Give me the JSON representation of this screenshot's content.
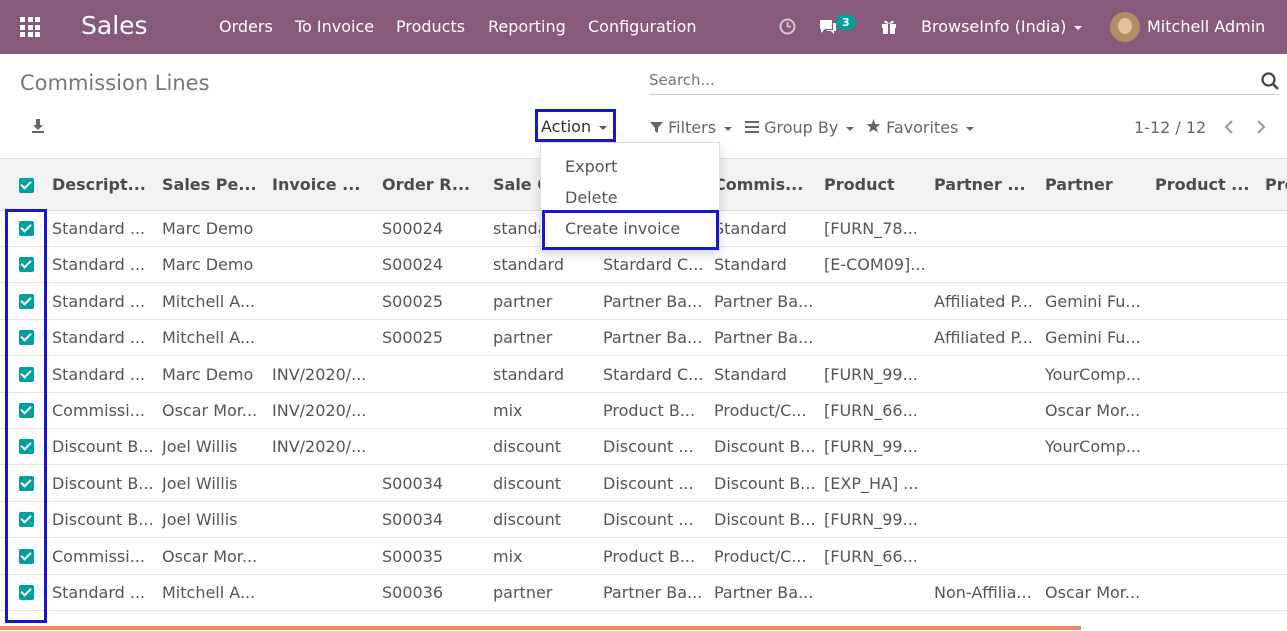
{
  "navbar": {
    "app_name": "Sales",
    "menu": [
      "Orders",
      "To Invoice",
      "Products",
      "Reporting",
      "Configuration"
    ],
    "message_count": "3",
    "company": "BrowseInfo (India)",
    "user": "Mitchell Admin",
    "color": "#875a7b"
  },
  "page": {
    "title": "Commission Lines",
    "search_placeholder": "Search...",
    "action_label": "Action",
    "filters_label": "Filters",
    "groupby_label": "Group By",
    "favorites_label": "Favorites",
    "pager": "1-12 / 12"
  },
  "action_menu": {
    "items": [
      "Export",
      "Delete",
      "Create invoice"
    ]
  },
  "table": {
    "headers": [
      "Descript...",
      "Sales Pe...",
      "Invoice ...",
      "Order R...",
      "Sale C",
      "Commis...",
      "Product",
      "Partner ...",
      "Partner",
      "Product ...",
      "Pro"
    ],
    "rows": [
      [
        "Standard ...",
        "Marc Demo",
        "",
        "S00024",
        "standa",
        "",
        "Standard",
        "[FURN_78...",
        "",
        "",
        ""
      ],
      [
        "Standard ...",
        "Marc Demo",
        "",
        "S00024",
        "standard",
        "Stardard C...",
        "Standard",
        "[E-COM09]...",
        "",
        "",
        ""
      ],
      [
        "Standard ...",
        "Mitchell A...",
        "",
        "S00025",
        "partner",
        "Partner Ba...",
        "Partner Ba...",
        "",
        "Affiliated P...",
        "Gemini Fu...",
        ""
      ],
      [
        "Standard ...",
        "Mitchell A...",
        "",
        "S00025",
        "partner",
        "Partner Ba...",
        "Partner Ba...",
        "",
        "Affiliated P...",
        "Gemini Fu...",
        ""
      ],
      [
        "Standard ...",
        "Marc Demo",
        "INV/2020/...",
        "",
        "standard",
        "Stardard C...",
        "Standard",
        "[FURN_99...",
        "",
        "YourComp...",
        ""
      ],
      [
        "Commissi...",
        "Oscar Mor...",
        "INV/2020/...",
        "",
        "mix",
        "Product B...",
        "Product/C...",
        "[FURN_66...",
        "",
        "Oscar Mor...",
        ""
      ],
      [
        "Discount B...",
        "Joel Willis",
        "INV/2020/...",
        "",
        "discount",
        "Discount ...",
        "Discount B...",
        "[FURN_99...",
        "",
        "YourComp...",
        ""
      ],
      [
        "Discount B...",
        "Joel Willis",
        "",
        "S00034",
        "discount",
        "Discount ...",
        "Discount B...",
        "[EXP_HA] ...",
        "",
        "",
        ""
      ],
      [
        "Discount B...",
        "Joel Willis",
        "",
        "S00034",
        "discount",
        "Discount ...",
        "Discount B...",
        "[FURN_99...",
        "",
        "",
        ""
      ],
      [
        "Commissi...",
        "Oscar Mor...",
        "",
        "S00035",
        "mix",
        "Product B...",
        "Product/C...",
        "[FURN_66...",
        "",
        "",
        ""
      ],
      [
        "Standard ...",
        "Mitchell A...",
        "",
        "S00036",
        "partner",
        "Partner Ba...",
        "Partner Ba...",
        "",
        "Non-Affilia...",
        "Oscar Mor...",
        ""
      ]
    ]
  }
}
